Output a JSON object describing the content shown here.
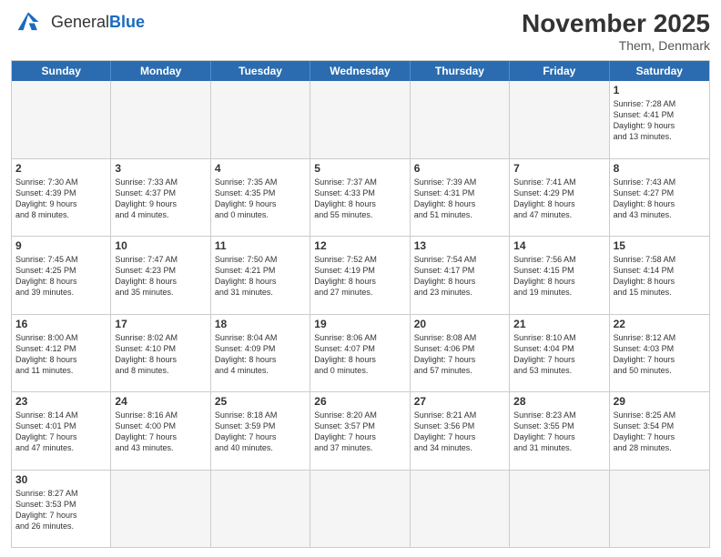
{
  "header": {
    "logo_general": "General",
    "logo_blue": "Blue",
    "month_year": "November 2025",
    "location": "Them, Denmark"
  },
  "days": [
    "Sunday",
    "Monday",
    "Tuesday",
    "Wednesday",
    "Thursday",
    "Friday",
    "Saturday"
  ],
  "cells": [
    {
      "day": null,
      "empty": true
    },
    {
      "day": null,
      "empty": true
    },
    {
      "day": null,
      "empty": true
    },
    {
      "day": null,
      "empty": true
    },
    {
      "day": null,
      "empty": true
    },
    {
      "day": null,
      "empty": true
    },
    {
      "day": 1,
      "info": "Sunrise: 7:28 AM\nSunset: 4:41 PM\nDaylight: 9 hours\nand 13 minutes."
    },
    {
      "day": 2,
      "info": "Sunrise: 7:30 AM\nSunset: 4:39 PM\nDaylight: 9 hours\nand 8 minutes."
    },
    {
      "day": 3,
      "info": "Sunrise: 7:33 AM\nSunset: 4:37 PM\nDaylight: 9 hours\nand 4 minutes."
    },
    {
      "day": 4,
      "info": "Sunrise: 7:35 AM\nSunset: 4:35 PM\nDaylight: 9 hours\nand 0 minutes."
    },
    {
      "day": 5,
      "info": "Sunrise: 7:37 AM\nSunset: 4:33 PM\nDaylight: 8 hours\nand 55 minutes."
    },
    {
      "day": 6,
      "info": "Sunrise: 7:39 AM\nSunset: 4:31 PM\nDaylight: 8 hours\nand 51 minutes."
    },
    {
      "day": 7,
      "info": "Sunrise: 7:41 AM\nSunset: 4:29 PM\nDaylight: 8 hours\nand 47 minutes."
    },
    {
      "day": 8,
      "info": "Sunrise: 7:43 AM\nSunset: 4:27 PM\nDaylight: 8 hours\nand 43 minutes."
    },
    {
      "day": 9,
      "info": "Sunrise: 7:45 AM\nSunset: 4:25 PM\nDaylight: 8 hours\nand 39 minutes."
    },
    {
      "day": 10,
      "info": "Sunrise: 7:47 AM\nSunset: 4:23 PM\nDaylight: 8 hours\nand 35 minutes."
    },
    {
      "day": 11,
      "info": "Sunrise: 7:50 AM\nSunset: 4:21 PM\nDaylight: 8 hours\nand 31 minutes."
    },
    {
      "day": 12,
      "info": "Sunrise: 7:52 AM\nSunset: 4:19 PM\nDaylight: 8 hours\nand 27 minutes."
    },
    {
      "day": 13,
      "info": "Sunrise: 7:54 AM\nSunset: 4:17 PM\nDaylight: 8 hours\nand 23 minutes."
    },
    {
      "day": 14,
      "info": "Sunrise: 7:56 AM\nSunset: 4:15 PM\nDaylight: 8 hours\nand 19 minutes."
    },
    {
      "day": 15,
      "info": "Sunrise: 7:58 AM\nSunset: 4:14 PM\nDaylight: 8 hours\nand 15 minutes."
    },
    {
      "day": 16,
      "info": "Sunrise: 8:00 AM\nSunset: 4:12 PM\nDaylight: 8 hours\nand 11 minutes."
    },
    {
      "day": 17,
      "info": "Sunrise: 8:02 AM\nSunset: 4:10 PM\nDaylight: 8 hours\nand 8 minutes."
    },
    {
      "day": 18,
      "info": "Sunrise: 8:04 AM\nSunset: 4:09 PM\nDaylight: 8 hours\nand 4 minutes."
    },
    {
      "day": 19,
      "info": "Sunrise: 8:06 AM\nSunset: 4:07 PM\nDaylight: 8 hours\nand 0 minutes."
    },
    {
      "day": 20,
      "info": "Sunrise: 8:08 AM\nSunset: 4:06 PM\nDaylight: 7 hours\nand 57 minutes."
    },
    {
      "day": 21,
      "info": "Sunrise: 8:10 AM\nSunset: 4:04 PM\nDaylight: 7 hours\nand 53 minutes."
    },
    {
      "day": 22,
      "info": "Sunrise: 8:12 AM\nSunset: 4:03 PM\nDaylight: 7 hours\nand 50 minutes."
    },
    {
      "day": 23,
      "info": "Sunrise: 8:14 AM\nSunset: 4:01 PM\nDaylight: 7 hours\nand 47 minutes."
    },
    {
      "day": 24,
      "info": "Sunrise: 8:16 AM\nSunset: 4:00 PM\nDaylight: 7 hours\nand 43 minutes."
    },
    {
      "day": 25,
      "info": "Sunrise: 8:18 AM\nSunset: 3:59 PM\nDaylight: 7 hours\nand 40 minutes."
    },
    {
      "day": 26,
      "info": "Sunrise: 8:20 AM\nSunset: 3:57 PM\nDaylight: 7 hours\nand 37 minutes."
    },
    {
      "day": 27,
      "info": "Sunrise: 8:21 AM\nSunset: 3:56 PM\nDaylight: 7 hours\nand 34 minutes."
    },
    {
      "day": 28,
      "info": "Sunrise: 8:23 AM\nSunset: 3:55 PM\nDaylight: 7 hours\nand 31 minutes."
    },
    {
      "day": 29,
      "info": "Sunrise: 8:25 AM\nSunset: 3:54 PM\nDaylight: 7 hours\nand 28 minutes."
    },
    {
      "day": 30,
      "info": "Sunrise: 8:27 AM\nSunset: 3:53 PM\nDaylight: 7 hours\nand 26 minutes."
    },
    {
      "day": null,
      "empty": true
    },
    {
      "day": null,
      "empty": true
    },
    {
      "day": null,
      "empty": true
    },
    {
      "day": null,
      "empty": true
    },
    {
      "day": null,
      "empty": true
    },
    {
      "day": null,
      "empty": true
    }
  ]
}
